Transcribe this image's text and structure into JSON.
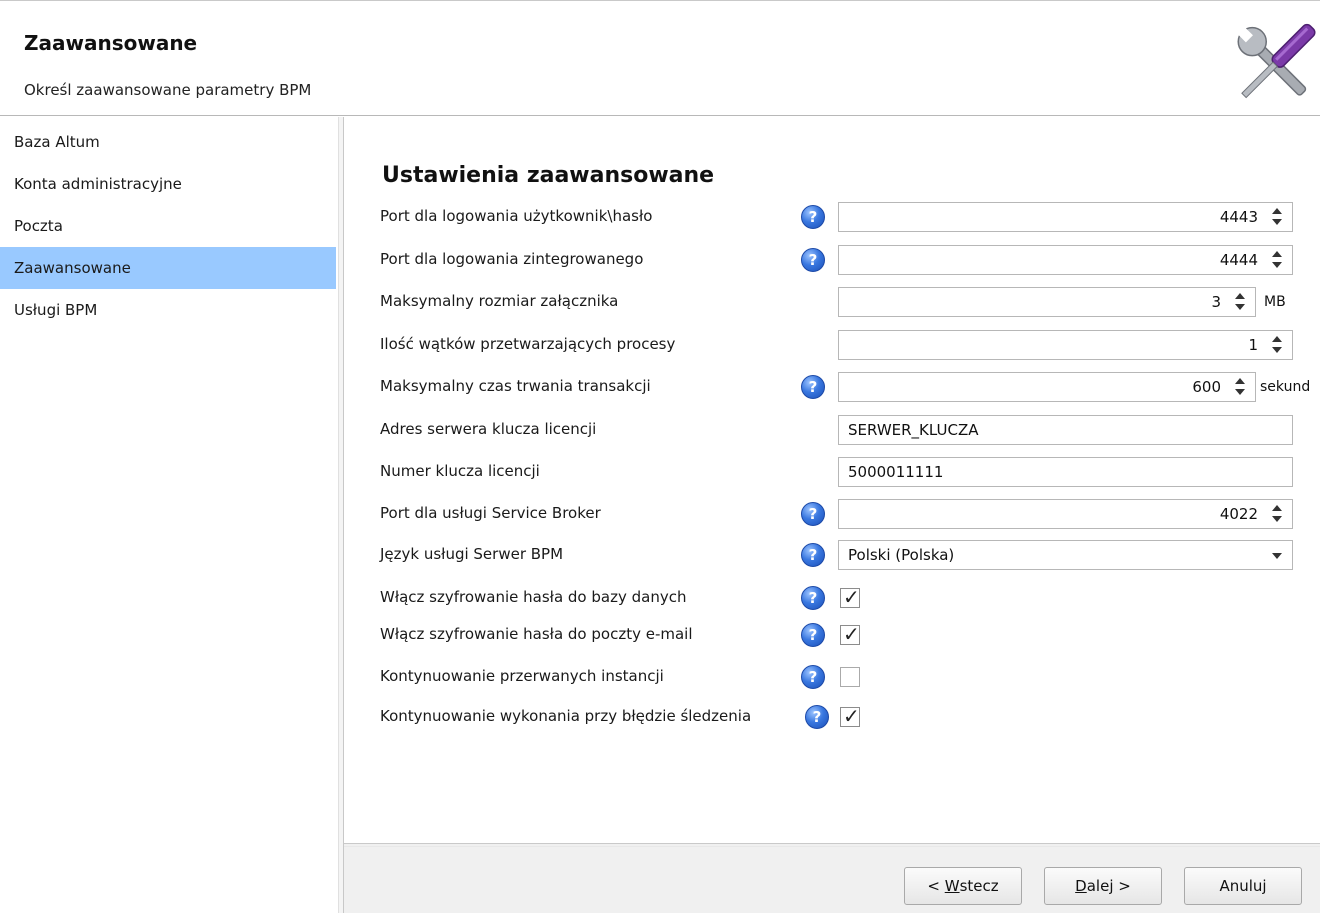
{
  "header": {
    "title": "Zaawansowane",
    "subtitle": "Określ zaawansowane parametry BPM",
    "logo_icon": "tools-icon"
  },
  "sidebar": {
    "items": [
      {
        "label": "Baza Altum",
        "active": false
      },
      {
        "label": "Konta administracyjne",
        "active": false
      },
      {
        "label": "Poczta",
        "active": false
      },
      {
        "label": "Zaawansowane",
        "active": true
      },
      {
        "label": "Usługi BPM",
        "active": false
      }
    ]
  },
  "main": {
    "section_title": "Ustawienia zaawansowane",
    "fields": {
      "port_userpass": {
        "label": "Port dla logowania użytkownik\\hasło",
        "value": "4443"
      },
      "port_integrated": {
        "label": "Port dla logowania zintegrowanego",
        "value": "4444"
      },
      "max_attachment": {
        "label": "Maksymalny rozmiar załącznika",
        "value": "3",
        "unit": "MB"
      },
      "thread_count": {
        "label": "Ilość wątków przetwarzających procesy",
        "value": "1"
      },
      "max_transaction": {
        "label": "Maksymalny czas trwania transakcji",
        "value": "600",
        "unit": "sekund"
      },
      "license_server": {
        "label": "Adres serwera klucza licencji",
        "value": "SERWER_KLUCZA"
      },
      "license_key": {
        "label": "Numer klucza licencji",
        "value": "5000011111"
      },
      "service_broker_port": {
        "label": "Port dla usługi Service Broker",
        "value": "4022"
      },
      "bpm_language": {
        "label": "Język usługi Serwer BPM",
        "value": "Polski (Polska)"
      },
      "encrypt_db": {
        "label": "Włącz szyfrowanie hasła do bazy danych",
        "checked": true
      },
      "encrypt_mail": {
        "label": "Włącz szyfrowanie hasła do poczty e-mail",
        "checked": true
      },
      "continue_instances": {
        "label": "Kontynuowanie przerwanych instancji",
        "checked": false
      },
      "continue_on_trace_error": {
        "label": "Kontynuowanie wykonania przy błędzie śledzenia",
        "checked": true
      }
    },
    "help_glyph": "?",
    "check_glyph": "✓"
  },
  "footer": {
    "back_prefix": "< ",
    "back_mnemonic": "W",
    "back_rest": "stecz",
    "next_mnemonic": "D",
    "next_rest": "alej >",
    "cancel": "Anuluj"
  }
}
